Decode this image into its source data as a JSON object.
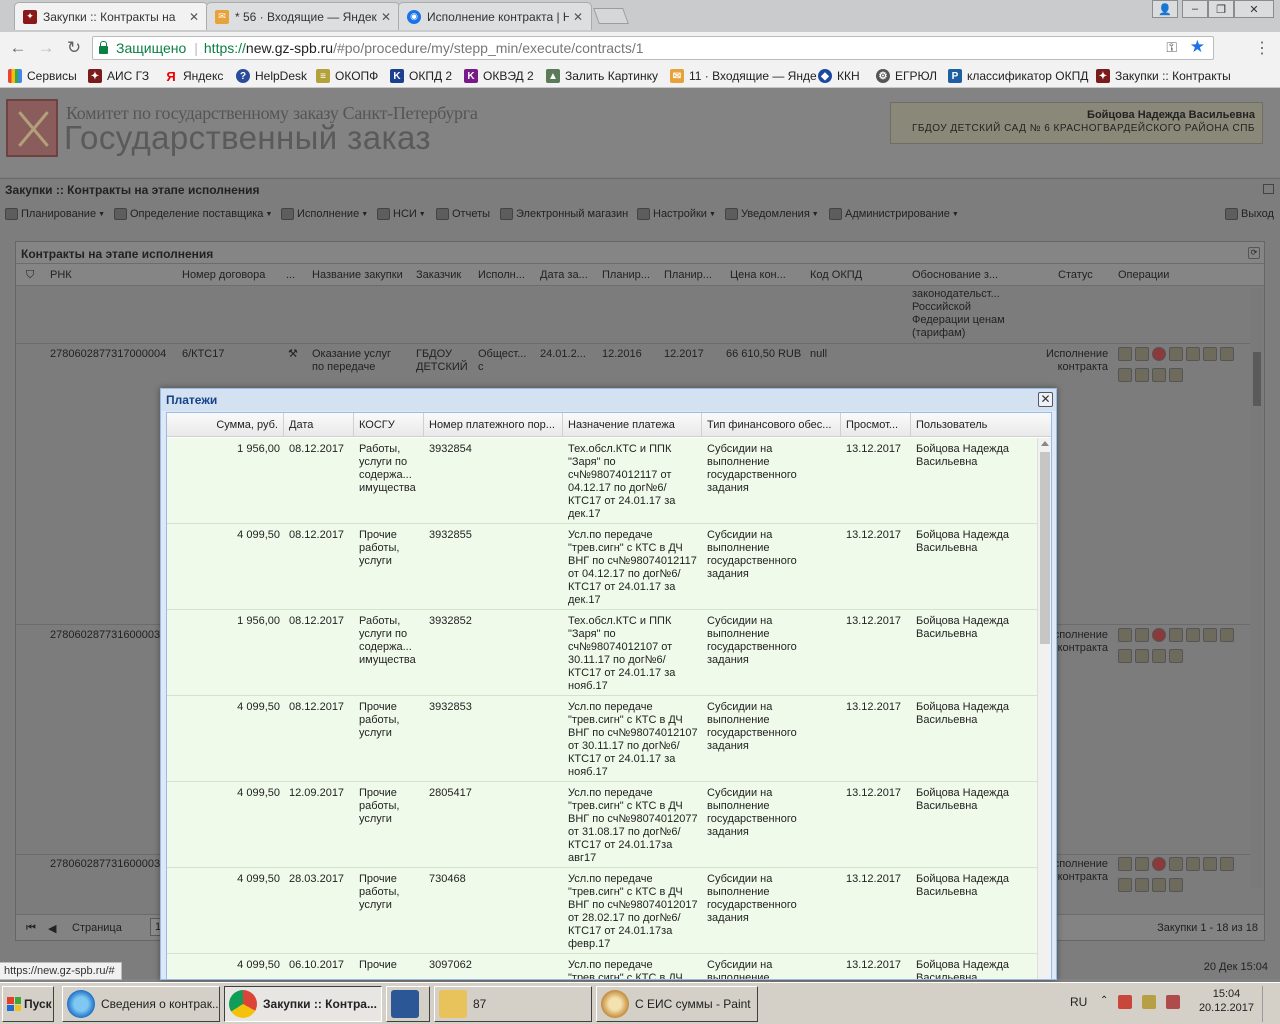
{
  "browser": {
    "tabs": [
      {
        "title": "Закупки :: Контракты на",
        "active": true
      },
      {
        "title": "* 56 · Входящие — Яндекс",
        "active": false
      },
      {
        "title": "Исполнение контракта | Н",
        "active": false
      }
    ],
    "secure_label": "Защищено",
    "url_scheme": "https://",
    "url_host": "new.gz-spb.ru",
    "url_path": "/#po/procedure/my/stepp_min/execute/contracts/1",
    "bookmarks": [
      "Сервисы",
      "АИС ГЗ",
      "Яндекс",
      "HelpDesk",
      "ОКОПФ",
      "ОКПД 2",
      "ОКВЭД 2",
      "Залить Картинку",
      "11 · Входящие — Янде",
      "ККН",
      "ЕГРЮЛ",
      "классификатор ОКПД",
      "Закупки :: Контракты"
    ]
  },
  "header": {
    "org_line1": "Комитет по государственному заказу Санкт-Петербурга",
    "org_line2": "Государственный заказ",
    "user_name": "Бойцова Надежда Васильевна",
    "user_org": "ГБДОУ ДЕТСКИЙ САД № 6 КРАСНОГВАРДЕЙСКОГО РАЙОНА СПБ"
  },
  "window_title": "Закупки :: Контракты на этапе исполнения",
  "menu": [
    "Планирование",
    "Определение поставщика",
    "Исполнение",
    "НСИ",
    "Отчеты",
    "Электронный магазин",
    "Настройки",
    "Уведомления",
    "Администрирование"
  ],
  "menu_exit": "Выход",
  "panel": {
    "title": "Контракты на этапе исполнения",
    "columns": [
      "РНК",
      "Номер договора",
      "...",
      "Название закупки",
      "Заказчик",
      "Исполн...",
      "Дата за...",
      "Планир...",
      "Планир...",
      "Цена кон...",
      "Код ОКПД",
      "Обоснование з...",
      "Статус",
      "Операции"
    ],
    "top_fragment": "законодательст...\nРоссийской\nФедерации ценам\n(тарифам)",
    "rows": [
      {
        "rnk": "2780602877317000004",
        "num": "6/КТС17",
        "name": "Оказание услуг\nпо передаче",
        "customer": "ГБДОУ\nДЕТСКИЙ",
        "exec": "Общест...\nс",
        "date": "24.01.2...",
        "plan1": "12.2016",
        "plan2": "12.2017",
        "price": "66 610,50 RUB",
        "okpd": "null",
        "status": "Исполнение\nконтракта"
      },
      {
        "rnk": "278060287731600003",
        "status": "исполнение\nконтракта"
      },
      {
        "rnk": "278060287731600003",
        "status": "исполнение\nконтракта"
      }
    ],
    "pager_label": "Страница",
    "pager_value": "1",
    "pager_info": "Закупки 1 - 18 из 18"
  },
  "footer_date": "20 Дек 15:04",
  "payments": {
    "title": "Платежи",
    "columns": [
      "Сумма, руб.",
      "Дата",
      "КОСГУ",
      "Номер платежного пор...",
      "Назначение платежа",
      "Тип финансового обес...",
      "Просмот...",
      "Пользователь"
    ],
    "rows": [
      {
        "sum": "1 956,00",
        "date": "08.12.2017",
        "kosgu": "Работы,\nуслуги по\nсодержа...\nимущества",
        "num": "3932854",
        "purpose": "Тех.обсл.КТС и ППК\n\"Заря\" по\nсч№98074012117 от\n04.12.17 по дог№6/\nКТС17 от 24.01.17 за\nдек.17",
        "fin": "Субсидии на\nвыполнение\nгосударственного\nзадания",
        "viewed": "13.12.2017",
        "user": "Бойцова Надежда\nВасильевна"
      },
      {
        "sum": "4 099,50",
        "date": "08.12.2017",
        "kosgu": "Прочие\nработы,\nуслуги",
        "num": "3932855",
        "purpose": "Усл.по передаче\n\"трев.сигн\" с КТС в ДЧ\nВНГ по сч№98074012117\nот 04.12.17 по дог№6/\nКТС17 от 24.01.17 за\nдек.17",
        "fin": "Субсидии на\nвыполнение\nгосударственного\nзадания",
        "viewed": "13.12.2017",
        "user": "Бойцова Надежда\nВасильевна"
      },
      {
        "sum": "1 956,00",
        "date": "08.12.2017",
        "kosgu": "Работы,\nуслуги по\nсодержа...\nимущества",
        "num": "3932852",
        "purpose": "Тех.обсл.КТС и ППК\n\"Заря\" по\nсч№98074012107 от\n30.11.17 по дог№6/\nКТС17 от 24.01.17 за\nнояб.17",
        "fin": "Субсидии на\nвыполнение\nгосударственного\nзадания",
        "viewed": "13.12.2017",
        "user": "Бойцова Надежда\nВасильевна"
      },
      {
        "sum": "4 099,50",
        "date": "08.12.2017",
        "kosgu": "Прочие\nработы,\nуслуги",
        "num": "3932853",
        "purpose": "Усл.по передаче\n\"трев.сигн\" с КТС в ДЧ\nВНГ по сч№98074012107\nот 30.11.17 по дог№6/\nКТС17 от 24.01.17 за\nнояб.17",
        "fin": "Субсидии на\nвыполнение\nгосударственного\nзадания",
        "viewed": "13.12.2017",
        "user": "Бойцова Надежда\nВасильевна"
      },
      {
        "sum": "4 099,50",
        "date": "12.09.2017",
        "kosgu": "Прочие\nработы,\nуслуги",
        "num": "2805417",
        "purpose": "Усл.по передаче\n\"трев.сигн\" с КТС в ДЧ\nВНГ по сч№98074012077\nот 31.08.17 по дог№6/\nКТС17 от 24.01.17за\nавг17",
        "fin": "Субсидии на\nвыполнение\nгосударственного\nзадания",
        "viewed": "13.12.2017",
        "user": "Бойцова Надежда\nВасильевна"
      },
      {
        "sum": "4 099,50",
        "date": "28.03.2017",
        "kosgu": "Прочие\nработы,\nуслуги",
        "num": "730468",
        "purpose": "Усл.по передаче\n\"трев.сигн\" с КТС в ДЧ\nВНГ по сч№98074012017\nот 28.02.17 по дог№6/\nКТС17 от 24.01.17за\nфевр.17",
        "fin": "Субсидии на\nвыполнение\nгосударственного\nзадания",
        "viewed": "13.12.2017",
        "user": "Бойцова Надежда\nВасильевна"
      },
      {
        "sum": "4 099,50",
        "date": "06.10.2017",
        "kosgu": "Прочие",
        "num": "3097062",
        "purpose": "Усл.по передаче\n\"трев.сигн\" с КТС в ДЧ",
        "fin": "Субсидии на\nвыполнение",
        "viewed": "13.12.2017",
        "user": "Бойцова Надежда\nВасильевна"
      }
    ]
  },
  "status_url": "https://new.gz-spb.ru/#",
  "taskbar": {
    "start": "Пуск",
    "items": [
      "Сведения о контрак...",
      "Закупки :: Контра...",
      "",
      "87",
      "С ЕИС суммы - Paint"
    ],
    "lang": "RU",
    "time": "15:04",
    "date": "20.12.2017"
  }
}
